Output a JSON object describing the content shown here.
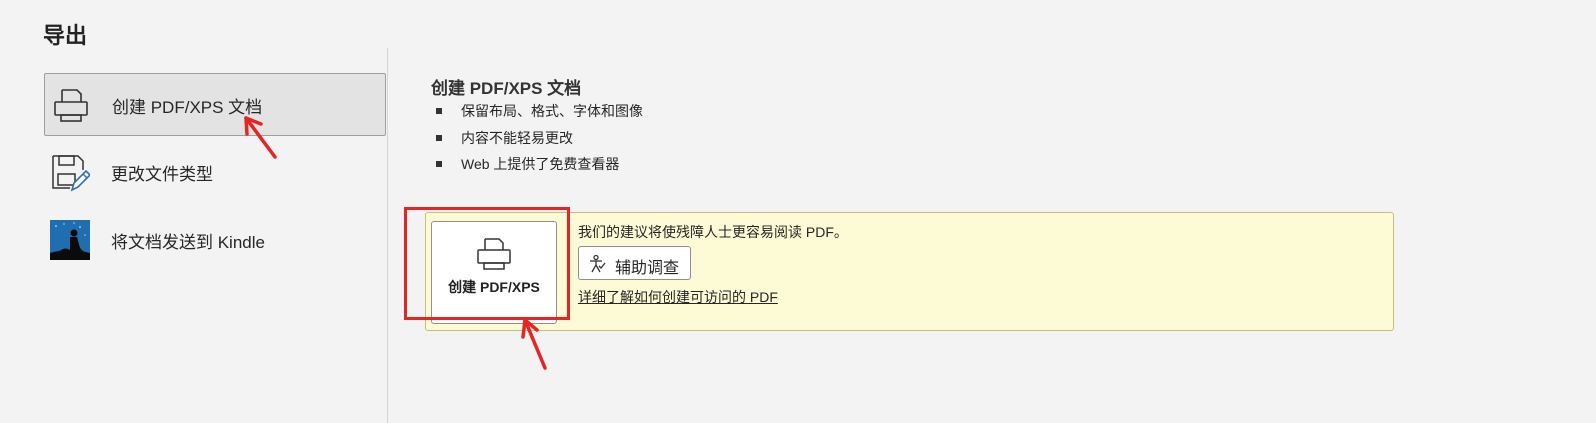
{
  "header": {
    "title": "导出"
  },
  "sidebar": {
    "items": [
      {
        "label": "创建 PDF/XPS 文档",
        "icon": "printer-icon",
        "selected": true
      },
      {
        "label": "更改文件类型",
        "icon": "file-edit-icon",
        "selected": false
      },
      {
        "label": "将文档发送到 Kindle",
        "icon": "kindle-icon",
        "selected": false
      }
    ]
  },
  "main": {
    "title": "创建 PDF/XPS 文档",
    "bullets": [
      "保留布局、格式、字体和图像",
      "内容不能轻易更改",
      "Web 上提供了免费查看器"
    ],
    "info_bar": {
      "create_button_label": "创建 PDF/XPS",
      "recommendation": "我们的建议将使残障人士更容易阅读 PDF。",
      "assist_button_label": "辅助调查",
      "learn_link": "详细了解如何创建可访问的 PDF"
    }
  },
  "colors": {
    "annotation": "#e52424",
    "info_bar_bg": "#fdfad6",
    "page_bg": "#f3f3f3"
  }
}
